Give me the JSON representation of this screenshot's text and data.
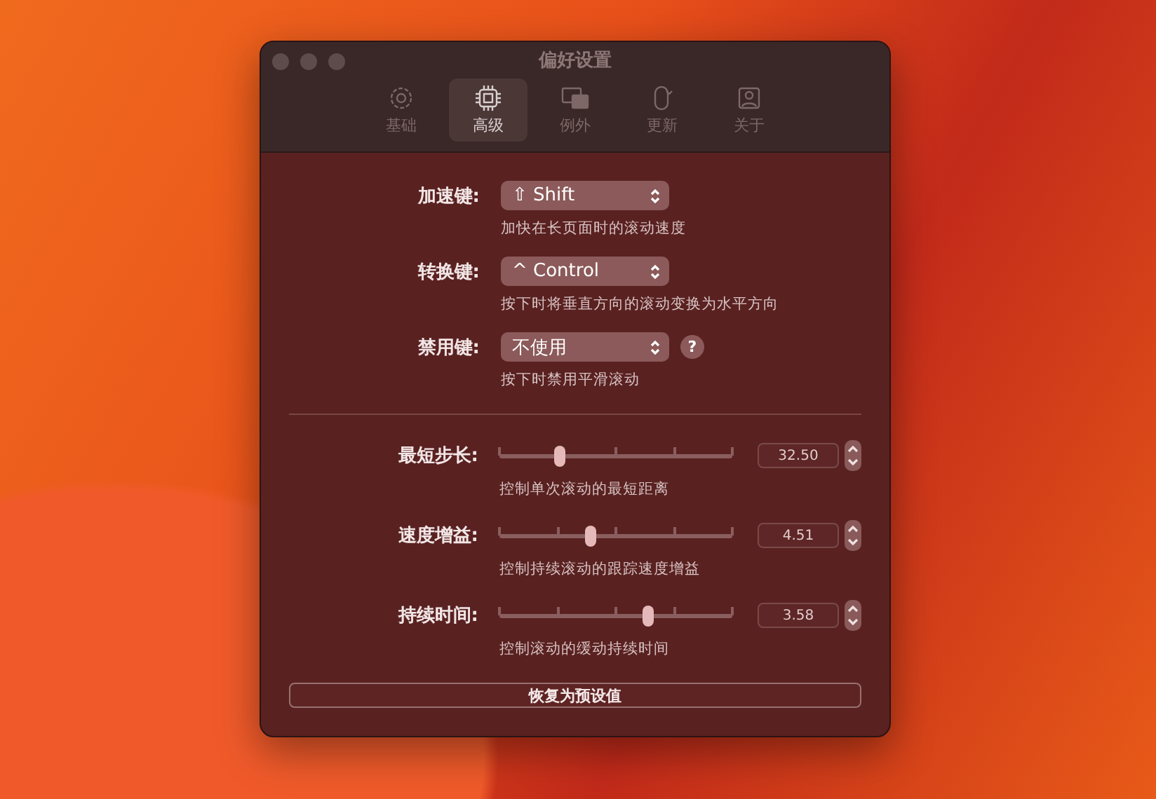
{
  "window": {
    "title": "偏好设置"
  },
  "tabs": [
    {
      "label": "基础",
      "selected": false
    },
    {
      "label": "高级",
      "selected": true
    },
    {
      "label": "例外",
      "selected": false
    },
    {
      "label": "更新",
      "selected": false
    },
    {
      "label": "关于",
      "selected": false
    }
  ],
  "keys": [
    {
      "label": "加速键:",
      "value": "⇧ Shift",
      "description": "加快在长页面时的滚动速度"
    },
    {
      "label": "转换键:",
      "value": "^ Control",
      "description": "按下时将垂直方向的滚动变换为水平方向"
    },
    {
      "label": "禁用键:",
      "value": "不使用",
      "description": "按下时禁用平滑滚动",
      "help_text": "?"
    }
  ],
  "sliders": [
    {
      "label": "最短步长:",
      "level": 0.26,
      "reading": "32.50",
      "description": "控制单次滚动的最短距离"
    },
    {
      "label": "速度增益:",
      "level": 0.39,
      "reading": "4.51",
      "description": "控制持续滚动的跟踪速度增益"
    },
    {
      "label": "持续时间:",
      "level": 0.64,
      "reading": "3.58",
      "description": "控制滚动的缓动持续时间"
    }
  ],
  "reset_button": "恢复为预设值"
}
